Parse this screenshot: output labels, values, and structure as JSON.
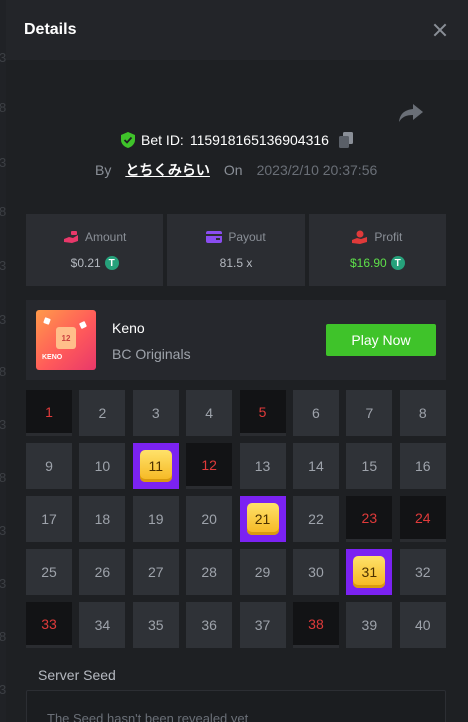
{
  "header": {
    "title": "Details"
  },
  "bet": {
    "label": "Bet ID:",
    "id": "115918165136904316"
  },
  "byline": {
    "by": "By",
    "user": "とちくみらい",
    "on": "On",
    "date": "2023/2/10 20:37:56"
  },
  "stats": [
    {
      "label": "Amount",
      "value": "$0.21",
      "coin": "T",
      "color": "#e8386a"
    },
    {
      "label": "Payout",
      "value": "81.5 x",
      "color": "#8a4df0"
    },
    {
      "label": "Profit",
      "value": "$16.90",
      "coin": "T",
      "color": "#e03a3a"
    }
  ],
  "game": {
    "name": "Keno",
    "provider": "BC Originals",
    "play_label": "Play Now",
    "thumb_number": "12",
    "thumb_caption": "KENO"
  },
  "grid": {
    "numbers": [
      "1",
      "2",
      "3",
      "4",
      "5",
      "6",
      "7",
      "8",
      "9",
      "10",
      "11",
      "12",
      "13",
      "14",
      "15",
      "16",
      "17",
      "18",
      "19",
      "20",
      "21",
      "22",
      "23",
      "24",
      "25",
      "26",
      "27",
      "28",
      "29",
      "30",
      "31",
      "32",
      "33",
      "34",
      "35",
      "36",
      "37",
      "38",
      "39",
      "40"
    ],
    "drawn": [
      1,
      5,
      12,
      23,
      24,
      33,
      38
    ],
    "hits": [
      11,
      21,
      31
    ]
  },
  "seed": {
    "label": "Server Seed",
    "placeholder": "The Seed hasn't been revealed yet"
  },
  "background_digits": [
    "8",
    "3",
    "3",
    "8",
    "3",
    "8",
    "3",
    "3",
    "8",
    "3",
    "3",
    "8",
    "3"
  ],
  "colors": {
    "accent_green": "#3fc32a",
    "profit_green": "#5ee04a",
    "drawn_red": "#e03a3a",
    "hit_purple": "#7b22f2",
    "tile_gold": "#f5b620"
  }
}
